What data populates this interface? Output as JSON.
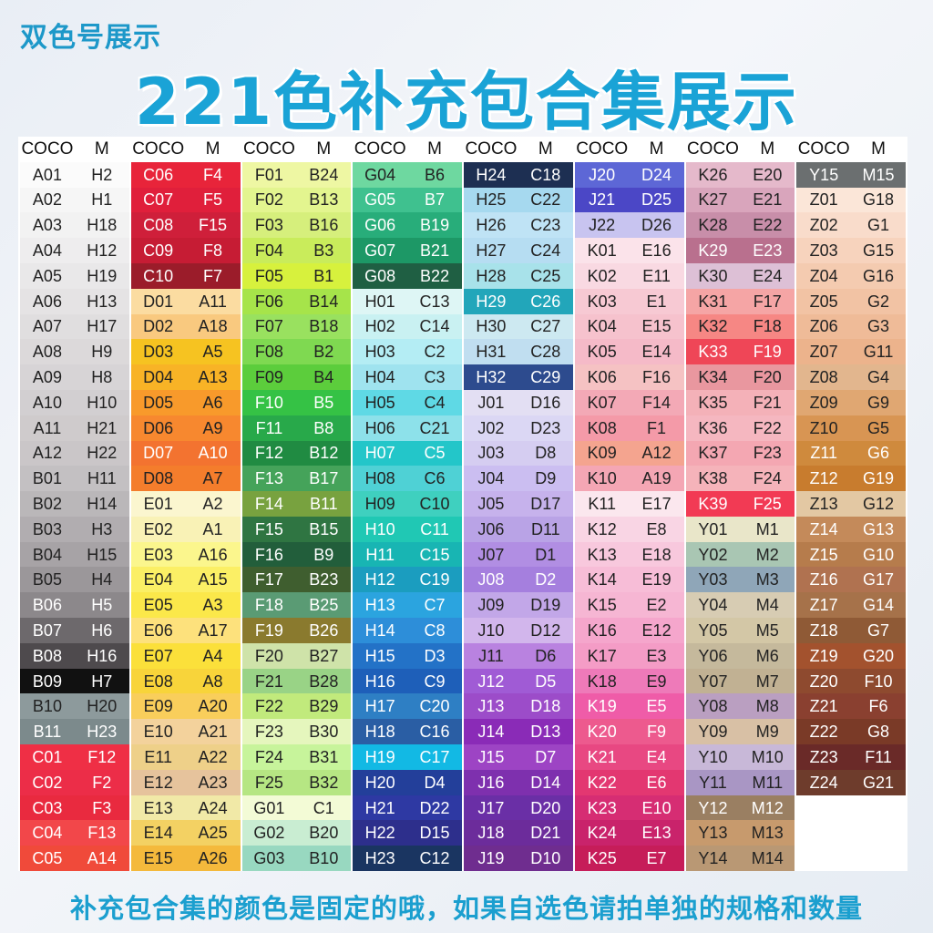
{
  "subtitle": "双色号展示",
  "title": "221色补充包合集展示",
  "footer": "补充包合集的颜色是固定的哦，如果自选色请拍单独的规格和数量",
  "header": {
    "coco": "COCO",
    "m": "M"
  },
  "columns": [
    [
      {
        "coco": "A01",
        "m": "H2",
        "color": "#fbfbfb"
      },
      {
        "coco": "A02",
        "m": "H1",
        "color": "#f6f6f6"
      },
      {
        "coco": "A03",
        "m": "H18",
        "color": "#f2f2f2"
      },
      {
        "coco": "A04",
        "m": "H12",
        "color": "#eeedee"
      },
      {
        "coco": "A05",
        "m": "H19",
        "color": "#e9e8e9"
      },
      {
        "coco": "A06",
        "m": "H13",
        "color": "#e5e3e4"
      },
      {
        "coco": "A07",
        "m": "H17",
        "color": "#e0dedf"
      },
      {
        "coco": "A08",
        "m": "H9",
        "color": "#dcd9da"
      },
      {
        "coco": "A09",
        "m": "H8",
        "color": "#d7d4d6"
      },
      {
        "coco": "A10",
        "m": "H10",
        "color": "#d2cfd1"
      },
      {
        "coco": "A11",
        "m": "H21",
        "color": "#cfcbcc"
      },
      {
        "coco": "A12",
        "m": "H22",
        "color": "#cac6c8"
      },
      {
        "coco": "B01",
        "m": "H11",
        "color": "#c3c0c2"
      },
      {
        "coco": "B02",
        "m": "H14",
        "color": "#bab7b9"
      },
      {
        "coco": "B03",
        "m": "H3",
        "color": "#b1adb0"
      },
      {
        "coco": "B04",
        "m": "H15",
        "color": "#a7a3a6"
      },
      {
        "coco": "B05",
        "m": "H4",
        "color": "#9b979a"
      },
      {
        "coco": "B06",
        "m": "H5",
        "color": "#8c888b"
      },
      {
        "coco": "B07",
        "m": "H6",
        "color": "#6d696c"
      },
      {
        "coco": "B08",
        "m": "H16",
        "color": "#4e4a4d"
      },
      {
        "coco": "B09",
        "m": "H7",
        "color": "#111111"
      },
      {
        "coco": "B10",
        "m": "H20",
        "color": "#8d9a9c"
      },
      {
        "coco": "B11",
        "m": "H23",
        "color": "#7c8a8c"
      },
      {
        "coco": "C01",
        "m": "F12",
        "color": "#ef2f45"
      },
      {
        "coco": "C02",
        "m": "F2",
        "color": "#ec2d48"
      },
      {
        "coco": "C03",
        "m": "F3",
        "color": "#e92a3f"
      },
      {
        "coco": "C04",
        "m": "F13",
        "color": "#f2474a"
      },
      {
        "coco": "C05",
        "m": "A14",
        "color": "#f04a3a"
      }
    ],
    [
      {
        "coco": "C06",
        "m": "F4",
        "color": "#e8243a"
      },
      {
        "coco": "C07",
        "m": "F5",
        "color": "#e01f3b"
      },
      {
        "coco": "C08",
        "m": "F15",
        "color": "#cf1f3a"
      },
      {
        "coco": "C09",
        "m": "F8",
        "color": "#c61c34"
      },
      {
        "coco": "C10",
        "m": "F7",
        "color": "#9b1c2a"
      },
      {
        "coco": "D01",
        "m": "A11",
        "color": "#fbdca1"
      },
      {
        "coco": "D02",
        "m": "A18",
        "color": "#f9c97f"
      },
      {
        "coco": "D03",
        "m": "A5",
        "color": "#f6c321"
      },
      {
        "coco": "D04",
        "m": "A13",
        "color": "#f8b326"
      },
      {
        "coco": "D05",
        "m": "A6",
        "color": "#f89a2b"
      },
      {
        "coco": "D06",
        "m": "A9",
        "color": "#f7882f"
      },
      {
        "coco": "D07",
        "m": "A10",
        "color": "#f37330"
      },
      {
        "coco": "D08",
        "m": "A7",
        "color": "#f47d2c"
      },
      {
        "coco": "E01",
        "m": "A2",
        "color": "#fbf6cf"
      },
      {
        "coco": "E02",
        "m": "A1",
        "color": "#f9f2b6"
      },
      {
        "coco": "E03",
        "m": "A16",
        "color": "#fbf68d"
      },
      {
        "coco": "E04",
        "m": "A15",
        "color": "#fbef65"
      },
      {
        "coco": "E05",
        "m": "A3",
        "color": "#fbe84a"
      },
      {
        "coco": "E06",
        "m": "A17",
        "color": "#fde17c"
      },
      {
        "coco": "E07",
        "m": "A4",
        "color": "#fbe03a"
      },
      {
        "coco": "E08",
        "m": "A8",
        "color": "#f8d43a"
      },
      {
        "coco": "E09",
        "m": "A20",
        "color": "#f9ce5b"
      },
      {
        "coco": "E10",
        "m": "A21",
        "color": "#f3d29c"
      },
      {
        "coco": "E11",
        "m": "A22",
        "color": "#eed089"
      },
      {
        "coco": "E12",
        "m": "A23",
        "color": "#e6c39c"
      },
      {
        "coco": "E13",
        "m": "A24",
        "color": "#f1e9a7"
      },
      {
        "coco": "E14",
        "m": "A25",
        "color": "#f3d163"
      },
      {
        "coco": "E15",
        "m": "A26",
        "color": "#f4b93c"
      }
    ],
    [
      {
        "coco": "F01",
        "m": "B24",
        "color": "#eef7a3"
      },
      {
        "coco": "F02",
        "m": "B13",
        "color": "#e3f58f"
      },
      {
        "coco": "F03",
        "m": "B16",
        "color": "#d6ef7c"
      },
      {
        "coco": "F04",
        "m": "B3",
        "color": "#c9ec5b"
      },
      {
        "coco": "F05",
        "m": "B1",
        "color": "#d7f13d"
      },
      {
        "coco": "F06",
        "m": "B14",
        "color": "#a6e44a"
      },
      {
        "coco": "F07",
        "m": "B18",
        "color": "#99e15f"
      },
      {
        "coco": "F08",
        "m": "B2",
        "color": "#7fd951"
      },
      {
        "coco": "F09",
        "m": "B4",
        "color": "#5ccd3c"
      },
      {
        "coco": "F10",
        "m": "B5",
        "color": "#35c245"
      },
      {
        "coco": "F11",
        "m": "B8",
        "color": "#28a94a"
      },
      {
        "coco": "F12",
        "m": "B12",
        "color": "#208b42"
      },
      {
        "coco": "F13",
        "m": "B17",
        "color": "#45a35a"
      },
      {
        "coco": "F14",
        "m": "B11",
        "color": "#78a23f"
      },
      {
        "coco": "F15",
        "m": "B15",
        "color": "#2f7542"
      },
      {
        "coco": "F16",
        "m": "B9",
        "color": "#225e3b"
      },
      {
        "coco": "F17",
        "m": "B23",
        "color": "#3f5e2f"
      },
      {
        "coco": "F18",
        "m": "B25",
        "color": "#5a9b74"
      },
      {
        "coco": "F19",
        "m": "B26",
        "color": "#8a7a2e"
      },
      {
        "coco": "F20",
        "m": "B27",
        "color": "#cfe3a9"
      },
      {
        "coco": "F21",
        "m": "B28",
        "color": "#99d386"
      },
      {
        "coco": "F22",
        "m": "B29",
        "color": "#c1ea7c"
      },
      {
        "coco": "F23",
        "m": "B30",
        "color": "#e5f6bd"
      },
      {
        "coco": "F24",
        "m": "B31",
        "color": "#c7f49b"
      },
      {
        "coco": "F25",
        "m": "B32",
        "color": "#b6e683"
      },
      {
        "coco": "G01",
        "m": "C1",
        "color": "#f3fbd6"
      },
      {
        "coco": "G02",
        "m": "B20",
        "color": "#c9edd2"
      },
      {
        "coco": "G03",
        "m": "B10",
        "color": "#98d8c0"
      }
    ],
    [
      {
        "coco": "G04",
        "m": "B6",
        "color": "#6ed8a0"
      },
      {
        "coco": "G05",
        "m": "B7",
        "color": "#3fc18f"
      },
      {
        "coco": "G06",
        "m": "B19",
        "color": "#28ad7a"
      },
      {
        "coco": "G07",
        "m": "B21",
        "color": "#1d9866"
      },
      {
        "coco": "G08",
        "m": "B22",
        "color": "#1f5f43"
      },
      {
        "coco": "H01",
        "m": "C13",
        "color": "#def6f5"
      },
      {
        "coco": "H02",
        "m": "C14",
        "color": "#c9f1f2"
      },
      {
        "coco": "H03",
        "m": "C2",
        "color": "#b4edf4"
      },
      {
        "coco": "H04",
        "m": "C3",
        "color": "#9fe3ef"
      },
      {
        "coco": "H05",
        "m": "C4",
        "color": "#5fd9e5"
      },
      {
        "coco": "H06",
        "m": "C21",
        "color": "#8de1ea"
      },
      {
        "coco": "H07",
        "m": "C5",
        "color": "#23c6c9"
      },
      {
        "coco": "H08",
        "m": "C6",
        "color": "#4fd1d5"
      },
      {
        "coco": "H09",
        "m": "C10",
        "color": "#3fd0bf"
      },
      {
        "coco": "H10",
        "m": "C11",
        "color": "#20c8b4"
      },
      {
        "coco": "H11",
        "m": "C15",
        "color": "#18b5b3"
      },
      {
        "coco": "H12",
        "m": "C19",
        "color": "#1b9dbf"
      },
      {
        "coco": "H13",
        "m": "C7",
        "color": "#2ba4df"
      },
      {
        "coco": "H14",
        "m": "C8",
        "color": "#2d8ed9"
      },
      {
        "coco": "H15",
        "m": "D3",
        "color": "#2372c7"
      },
      {
        "coco": "H16",
        "m": "C9",
        "color": "#1e5fb9"
      },
      {
        "coco": "H17",
        "m": "C20",
        "color": "#2e7fc4"
      },
      {
        "coco": "H18",
        "m": "C16",
        "color": "#2a5ea4"
      },
      {
        "coco": "H19",
        "m": "C17",
        "color": "#12b9e4"
      },
      {
        "coco": "H20",
        "m": "D4",
        "color": "#233f9a"
      },
      {
        "coco": "H21",
        "m": "D22",
        "color": "#2e39a3"
      },
      {
        "coco": "H22",
        "m": "D15",
        "color": "#2d2f8c"
      },
      {
        "coco": "H23",
        "m": "C12",
        "color": "#1a3561"
      }
    ],
    [
      {
        "coco": "H24",
        "m": "C18",
        "color": "#1d2f52"
      },
      {
        "coco": "H25",
        "m": "C22",
        "color": "#a6d9ef"
      },
      {
        "coco": "H26",
        "m": "C23",
        "color": "#bfe3f5"
      },
      {
        "coco": "H27",
        "m": "C24",
        "color": "#b6ddf2"
      },
      {
        "coco": "H28",
        "m": "C25",
        "color": "#a8e2ea"
      },
      {
        "coco": "H29",
        "m": "C26",
        "color": "#22a6ba"
      },
      {
        "coco": "H30",
        "m": "C27",
        "color": "#cde9f1"
      },
      {
        "coco": "H31",
        "m": "C28",
        "color": "#c0def0"
      },
      {
        "coco": "H32",
        "m": "C29",
        "color": "#2d4b8e"
      },
      {
        "coco": "J01",
        "m": "D16",
        "color": "#e3dff3"
      },
      {
        "coco": "J02",
        "m": "D23",
        "color": "#dbd7f4"
      },
      {
        "coco": "J03",
        "m": "D8",
        "color": "#d5cdf1"
      },
      {
        "coco": "J04",
        "m": "D9",
        "color": "#cbbef1"
      },
      {
        "coco": "J05",
        "m": "D17",
        "color": "#c6b2ec"
      },
      {
        "coco": "J06",
        "m": "D11",
        "color": "#b9a3e6"
      },
      {
        "coco": "J07",
        "m": "D1",
        "color": "#b18ee3"
      },
      {
        "coco": "J08",
        "m": "D2",
        "color": "#a57fde"
      },
      {
        "coco": "J09",
        "m": "D19",
        "color": "#c2a7e8"
      },
      {
        "coco": "J10",
        "m": "D12",
        "color": "#d2b6ec"
      },
      {
        "coco": "J11",
        "m": "D6",
        "color": "#b982e0"
      },
      {
        "coco": "J12",
        "m": "D5",
        "color": "#a05bd5"
      },
      {
        "coco": "J13",
        "m": "D18",
        "color": "#9c4cc9"
      },
      {
        "coco": "J14",
        "m": "D13",
        "color": "#8a2bb7"
      },
      {
        "coco": "J15",
        "m": "D7",
        "color": "#9d44c4"
      },
      {
        "coco": "J16",
        "m": "D14",
        "color": "#7e30ae"
      },
      {
        "coco": "J17",
        "m": "D20",
        "color": "#6a2fa6"
      },
      {
        "coco": "J18",
        "m": "D21",
        "color": "#6c2c9b"
      },
      {
        "coco": "J19",
        "m": "D10",
        "color": "#6f2d8f"
      }
    ],
    [
      {
        "coco": "J20",
        "m": "D24",
        "color": "#5d67d6"
      },
      {
        "coco": "J21",
        "m": "D25",
        "color": "#4b47c6"
      },
      {
        "coco": "J22",
        "m": "D26",
        "color": "#c8c4f0"
      },
      {
        "coco": "K01",
        "m": "E16",
        "color": "#fbe3ea"
      },
      {
        "coco": "K02",
        "m": "E11",
        "color": "#f9d9e2"
      },
      {
        "coco": "K03",
        "m": "E1",
        "color": "#f7c9d3"
      },
      {
        "coco": "K04",
        "m": "E15",
        "color": "#f6c2cd"
      },
      {
        "coco": "K05",
        "m": "E14",
        "color": "#f5bac8"
      },
      {
        "coco": "K06",
        "m": "F16",
        "color": "#f5c2c3"
      },
      {
        "coco": "K07",
        "m": "F14",
        "color": "#f3a9b6"
      },
      {
        "coco": "K08",
        "m": "F1",
        "color": "#f49aa8"
      },
      {
        "coco": "K09",
        "m": "A12",
        "color": "#f4a48f"
      },
      {
        "coco": "K10",
        "m": "A19",
        "color": "#f4a6b4"
      },
      {
        "coco": "K11",
        "m": "E17",
        "color": "#fbe7ee"
      },
      {
        "coco": "K12",
        "m": "E8",
        "color": "#f9d5e4"
      },
      {
        "coco": "K13",
        "m": "E18",
        "color": "#f8c8dd"
      },
      {
        "coco": "K14",
        "m": "E19",
        "color": "#f7bdd7"
      },
      {
        "coco": "K15",
        "m": "E2",
        "color": "#f6b6d3"
      },
      {
        "coco": "K16",
        "m": "E12",
        "color": "#f5a6cc"
      },
      {
        "coco": "K17",
        "m": "E3",
        "color": "#f49cc6"
      },
      {
        "coco": "K18",
        "m": "E9",
        "color": "#ee7ab9"
      },
      {
        "coco": "K19",
        "m": "E5",
        "color": "#ef5ca8"
      },
      {
        "coco": "K20",
        "m": "F9",
        "color": "#ed5a8e"
      },
      {
        "coco": "K21",
        "m": "E4",
        "color": "#e84882"
      },
      {
        "coco": "K22",
        "m": "E6",
        "color": "#e33771"
      },
      {
        "coco": "K23",
        "m": "E10",
        "color": "#d62d73"
      },
      {
        "coco": "K24",
        "m": "E13",
        "color": "#c9236b"
      },
      {
        "coco": "K25",
        "m": "E7",
        "color": "#c61d59"
      }
    ],
    [
      {
        "coco": "K26",
        "m": "E20",
        "color": "#e5b9cb"
      },
      {
        "coco": "K27",
        "m": "E21",
        "color": "#d9a5bc"
      },
      {
        "coco": "K28",
        "m": "E22",
        "color": "#c88ea9"
      },
      {
        "coco": "K29",
        "m": "E23",
        "color": "#b9708e"
      },
      {
        "coco": "K30",
        "m": "E24",
        "color": "#ddc0d6"
      },
      {
        "coco": "K31",
        "m": "F17",
        "color": "#f5a5a5"
      },
      {
        "coco": "K32",
        "m": "F18",
        "color": "#f68784"
      },
      {
        "coco": "K33",
        "m": "F19",
        "color": "#ef4657"
      },
      {
        "coco": "K34",
        "m": "F20",
        "color": "#e9979f"
      },
      {
        "coco": "K35",
        "m": "F21",
        "color": "#f4b1b8"
      },
      {
        "coco": "K36",
        "m": "F22",
        "color": "#f5b7c0"
      },
      {
        "coco": "K37",
        "m": "F23",
        "color": "#f4a7b2"
      },
      {
        "coco": "K38",
        "m": "F24",
        "color": "#f5b3ba"
      },
      {
        "coco": "K39",
        "m": "F25",
        "color": "#f23a54"
      },
      {
        "coco": "Y01",
        "m": "M1",
        "color": "#e9e6c9"
      },
      {
        "coco": "Y02",
        "m": "M2",
        "color": "#a9c6b3"
      },
      {
        "coco": "Y03",
        "m": "M3",
        "color": "#8fa6b8"
      },
      {
        "coco": "Y04",
        "m": "M4",
        "color": "#d7ccb3"
      },
      {
        "coco": "Y05",
        "m": "M5",
        "color": "#d3c7a6"
      },
      {
        "coco": "Y06",
        "m": "M6",
        "color": "#c5b99c"
      },
      {
        "coco": "Y07",
        "m": "M7",
        "color": "#c1b193"
      },
      {
        "coco": "Y08",
        "m": "M8",
        "color": "#ba9fc1"
      },
      {
        "coco": "Y09",
        "m": "M9",
        "color": "#d8c0a5"
      },
      {
        "coco": "Y10",
        "m": "M10",
        "color": "#c8b8d8"
      },
      {
        "coco": "Y11",
        "m": "M11",
        "color": "#a996c4"
      },
      {
        "coco": "Y12",
        "m": "M12",
        "color": "#9a7f62"
      },
      {
        "coco": "Y13",
        "m": "M13",
        "color": "#c79a6d"
      },
      {
        "coco": "Y14",
        "m": "M14",
        "color": "#b99874"
      }
    ],
    [
      {
        "coco": "Y15",
        "m": "M15",
        "color": "#6b6f70"
      },
      {
        "coco": "Z01",
        "m": "G18",
        "color": "#fbe6d8"
      },
      {
        "coco": "Z02",
        "m": "G1",
        "color": "#f9dccb"
      },
      {
        "coco": "Z03",
        "m": "G15",
        "color": "#f7d3bd"
      },
      {
        "coco": "Z04",
        "m": "G16",
        "color": "#f4cbb0"
      },
      {
        "coco": "Z05",
        "m": "G2",
        "color": "#f2c3a4"
      },
      {
        "coco": "Z06",
        "m": "G3",
        "color": "#efbb98"
      },
      {
        "coco": "Z07",
        "m": "G11",
        "color": "#ecb38c"
      },
      {
        "coco": "Z08",
        "m": "G4",
        "color": "#e2b68e"
      },
      {
        "coco": "Z09",
        "m": "G9",
        "color": "#e0a772"
      },
      {
        "coco": "Z10",
        "m": "G5",
        "color": "#d89553"
      },
      {
        "coco": "Z11",
        "m": "G6",
        "color": "#cf8a3d"
      },
      {
        "coco": "Z12",
        "m": "G19",
        "color": "#c87c2e"
      },
      {
        "coco": "Z13",
        "m": "G12",
        "color": "#e3c8a3"
      },
      {
        "coco": "Z14",
        "m": "G13",
        "color": "#c48a5a"
      },
      {
        "coco": "Z15",
        "m": "G10",
        "color": "#b67c4c"
      },
      {
        "coco": "Z16",
        "m": "G17",
        "color": "#b07250"
      },
      {
        "coco": "Z17",
        "m": "G14",
        "color": "#a6724a"
      },
      {
        "coco": "Z18",
        "m": "G7",
        "color": "#8f5a36"
      },
      {
        "coco": "Z19",
        "m": "G20",
        "color": "#a3522e"
      },
      {
        "coco": "Z20",
        "m": "F10",
        "color": "#8e4a2f"
      },
      {
        "coco": "Z21",
        "m": "F6",
        "color": "#8a4030"
      },
      {
        "coco": "Z22",
        "m": "G8",
        "color": "#7a3a27"
      },
      {
        "coco": "Z23",
        "m": "F11",
        "color": "#6a2a28"
      },
      {
        "coco": "Z24",
        "m": "G21",
        "color": "#6e3c2c"
      },
      {
        "coco": "",
        "m": "",
        "color": "#ffffff"
      },
      {
        "coco": "",
        "m": "",
        "color": "#ffffff"
      },
      {
        "coco": "",
        "m": "",
        "color": "#ffffff"
      }
    ]
  ]
}
